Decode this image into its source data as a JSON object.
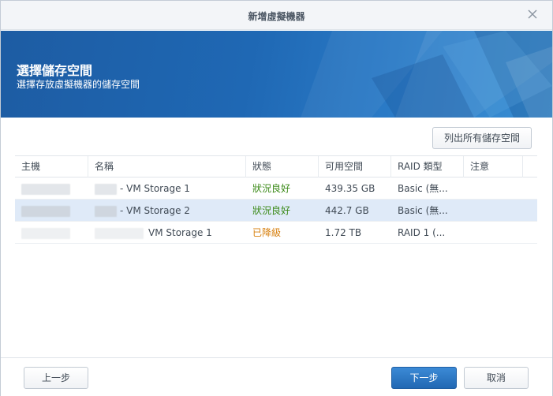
{
  "window": {
    "title": "新增虛擬機器"
  },
  "banner": {
    "heading": "選擇儲存空間",
    "subheading": "選擇存放虛擬機器的儲存空間"
  },
  "toolbar": {
    "list_all_label": "列出所有儲存空間"
  },
  "table": {
    "columns": [
      "主機",
      "名稱",
      "狀態",
      "可用空間",
      "RAID 類型",
      "注意"
    ],
    "rows": [
      {
        "name": "- VM Storage 1",
        "status": "狀況良好",
        "status_kind": "ok",
        "space": "439.35 GB",
        "raid": "Basic (無...",
        "note": ""
      },
      {
        "name": "- VM Storage 2",
        "status": "狀況良好",
        "status_kind": "ok",
        "space": "442.7 GB",
        "raid": "Basic (無...",
        "note": ""
      },
      {
        "name": "VM Storage 1",
        "status": "已降級",
        "status_kind": "warn",
        "space": "1.72 TB",
        "raid": "RAID 1 (...",
        "note": ""
      }
    ],
    "selected_index": 1
  },
  "footer": {
    "back_label": "上一步",
    "next_label": "下一步",
    "cancel_label": "取消"
  },
  "icons": {
    "close": "close-icon"
  },
  "colors": {
    "banner": "#1f68b4",
    "selected_row": "#dfeaf8",
    "ok": "#3b8a18",
    "warn": "#d77f0d",
    "primary": "#2a73c0"
  }
}
